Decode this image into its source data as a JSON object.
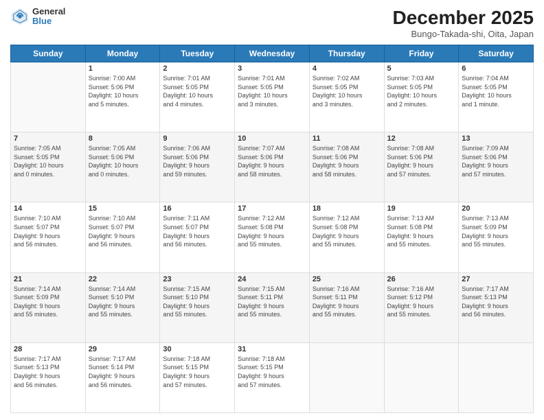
{
  "header": {
    "logo_general": "General",
    "logo_blue": "Blue",
    "month_title": "December 2025",
    "subtitle": "Bungo-Takada-shi, Oita, Japan"
  },
  "days_of_week": [
    "Sunday",
    "Monday",
    "Tuesday",
    "Wednesday",
    "Thursday",
    "Friday",
    "Saturday"
  ],
  "weeks": [
    [
      {
        "day": "",
        "info": ""
      },
      {
        "day": "1",
        "info": "Sunrise: 7:00 AM\nSunset: 5:06 PM\nDaylight: 10 hours\nand 5 minutes."
      },
      {
        "day": "2",
        "info": "Sunrise: 7:01 AM\nSunset: 5:05 PM\nDaylight: 10 hours\nand 4 minutes."
      },
      {
        "day": "3",
        "info": "Sunrise: 7:01 AM\nSunset: 5:05 PM\nDaylight: 10 hours\nand 3 minutes."
      },
      {
        "day": "4",
        "info": "Sunrise: 7:02 AM\nSunset: 5:05 PM\nDaylight: 10 hours\nand 3 minutes."
      },
      {
        "day": "5",
        "info": "Sunrise: 7:03 AM\nSunset: 5:05 PM\nDaylight: 10 hours\nand 2 minutes."
      },
      {
        "day": "6",
        "info": "Sunrise: 7:04 AM\nSunset: 5:05 PM\nDaylight: 10 hours\nand 1 minute."
      }
    ],
    [
      {
        "day": "7",
        "info": "Sunrise: 7:05 AM\nSunset: 5:05 PM\nDaylight: 10 hours\nand 0 minutes."
      },
      {
        "day": "8",
        "info": "Sunrise: 7:05 AM\nSunset: 5:06 PM\nDaylight: 10 hours\nand 0 minutes."
      },
      {
        "day": "9",
        "info": "Sunrise: 7:06 AM\nSunset: 5:06 PM\nDaylight: 9 hours\nand 59 minutes."
      },
      {
        "day": "10",
        "info": "Sunrise: 7:07 AM\nSunset: 5:06 PM\nDaylight: 9 hours\nand 58 minutes."
      },
      {
        "day": "11",
        "info": "Sunrise: 7:08 AM\nSunset: 5:06 PM\nDaylight: 9 hours\nand 58 minutes."
      },
      {
        "day": "12",
        "info": "Sunrise: 7:08 AM\nSunset: 5:06 PM\nDaylight: 9 hours\nand 57 minutes."
      },
      {
        "day": "13",
        "info": "Sunrise: 7:09 AM\nSunset: 5:06 PM\nDaylight: 9 hours\nand 57 minutes."
      }
    ],
    [
      {
        "day": "14",
        "info": "Sunrise: 7:10 AM\nSunset: 5:07 PM\nDaylight: 9 hours\nand 56 minutes."
      },
      {
        "day": "15",
        "info": "Sunrise: 7:10 AM\nSunset: 5:07 PM\nDaylight: 9 hours\nand 56 minutes."
      },
      {
        "day": "16",
        "info": "Sunrise: 7:11 AM\nSunset: 5:07 PM\nDaylight: 9 hours\nand 56 minutes."
      },
      {
        "day": "17",
        "info": "Sunrise: 7:12 AM\nSunset: 5:08 PM\nDaylight: 9 hours\nand 55 minutes."
      },
      {
        "day": "18",
        "info": "Sunrise: 7:12 AM\nSunset: 5:08 PM\nDaylight: 9 hours\nand 55 minutes."
      },
      {
        "day": "19",
        "info": "Sunrise: 7:13 AM\nSunset: 5:08 PM\nDaylight: 9 hours\nand 55 minutes."
      },
      {
        "day": "20",
        "info": "Sunrise: 7:13 AM\nSunset: 5:09 PM\nDaylight: 9 hours\nand 55 minutes."
      }
    ],
    [
      {
        "day": "21",
        "info": "Sunrise: 7:14 AM\nSunset: 5:09 PM\nDaylight: 9 hours\nand 55 minutes."
      },
      {
        "day": "22",
        "info": "Sunrise: 7:14 AM\nSunset: 5:10 PM\nDaylight: 9 hours\nand 55 minutes."
      },
      {
        "day": "23",
        "info": "Sunrise: 7:15 AM\nSunset: 5:10 PM\nDaylight: 9 hours\nand 55 minutes."
      },
      {
        "day": "24",
        "info": "Sunrise: 7:15 AM\nSunset: 5:11 PM\nDaylight: 9 hours\nand 55 minutes."
      },
      {
        "day": "25",
        "info": "Sunrise: 7:16 AM\nSunset: 5:11 PM\nDaylight: 9 hours\nand 55 minutes."
      },
      {
        "day": "26",
        "info": "Sunrise: 7:16 AM\nSunset: 5:12 PM\nDaylight: 9 hours\nand 55 minutes."
      },
      {
        "day": "27",
        "info": "Sunrise: 7:17 AM\nSunset: 5:13 PM\nDaylight: 9 hours\nand 56 minutes."
      }
    ],
    [
      {
        "day": "28",
        "info": "Sunrise: 7:17 AM\nSunset: 5:13 PM\nDaylight: 9 hours\nand 56 minutes."
      },
      {
        "day": "29",
        "info": "Sunrise: 7:17 AM\nSunset: 5:14 PM\nDaylight: 9 hours\nand 56 minutes."
      },
      {
        "day": "30",
        "info": "Sunrise: 7:18 AM\nSunset: 5:15 PM\nDaylight: 9 hours\nand 57 minutes."
      },
      {
        "day": "31",
        "info": "Sunrise: 7:18 AM\nSunset: 5:15 PM\nDaylight: 9 hours\nand 57 minutes."
      },
      {
        "day": "",
        "info": ""
      },
      {
        "day": "",
        "info": ""
      },
      {
        "day": "",
        "info": ""
      }
    ]
  ]
}
